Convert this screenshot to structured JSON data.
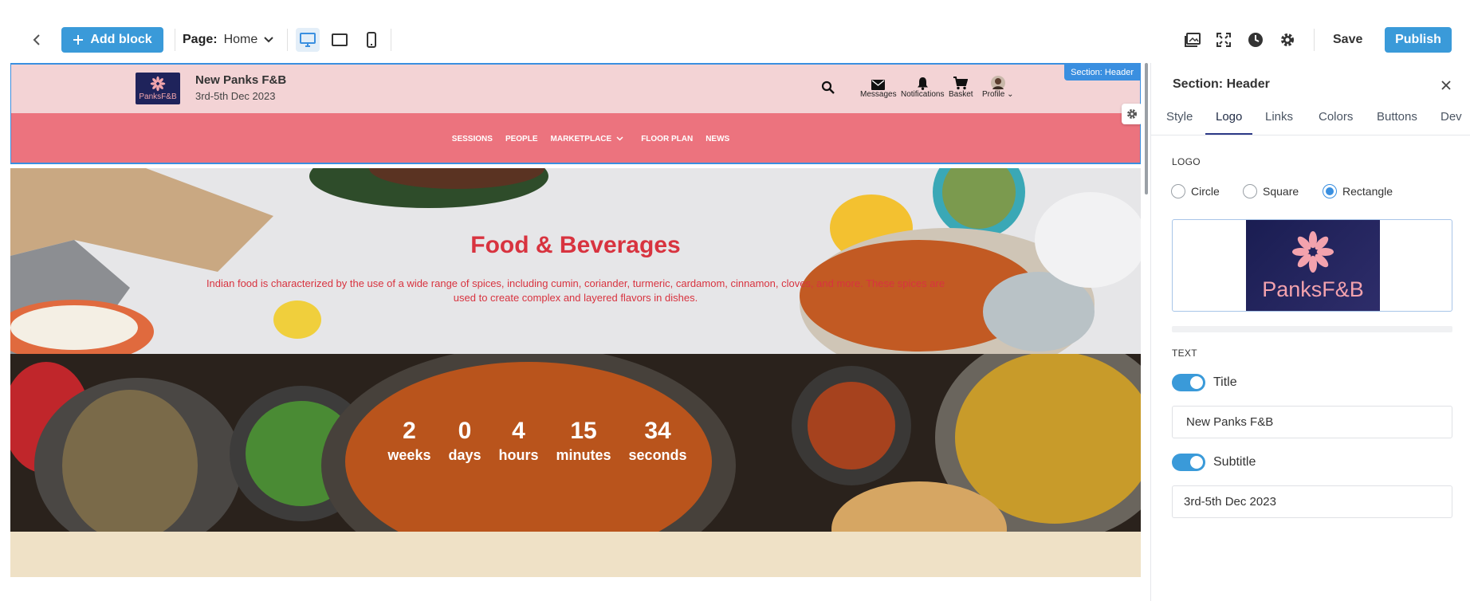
{
  "toolbar": {
    "add_block_label": "Add block",
    "page_label": "Page:",
    "page_value": "Home",
    "save_label": "Save",
    "publish_label": "Publish",
    "accent": "#3a9ad9"
  },
  "header": {
    "section_tag": "Section: Header",
    "logo_text": "PanksF&B",
    "title": "New Panks F&B",
    "subtitle": "3rd-5th Dec 2023",
    "icons": [
      {
        "label": "Messages",
        "icon": "mail-icon"
      },
      {
        "label": "Notifications",
        "icon": "bell-icon"
      },
      {
        "label": "Basket",
        "icon": "cart-icon"
      },
      {
        "label": "Profile",
        "icon": "avatar"
      }
    ],
    "nav": [
      "SESSIONS",
      "PEOPLE",
      "MARKETPLACE",
      "FLOOR PLAN",
      "NEWS"
    ],
    "top_color": "#f3d3d5",
    "nav_color": "#ec737e"
  },
  "hero": {
    "title": "Food & Beverages",
    "description": "Indian food is characterized by the use of a wide range of spices, including cumin, coriander, turmeric, cardamom, cinnamon, cloves, and more. These spices are used to create complex and layered flavors in dishes.",
    "text_color": "#d8333f"
  },
  "countdown": [
    {
      "value": "2",
      "label": "weeks"
    },
    {
      "value": "0",
      "label": "days"
    },
    {
      "value": "4",
      "label": "hours"
    },
    {
      "value": "15",
      "label": "minutes"
    },
    {
      "value": "34",
      "label": "seconds"
    }
  ],
  "panel": {
    "title": "Section: Header",
    "tabs": [
      "Style",
      "Logo",
      "Links",
      "Colors",
      "Buttons",
      "Dev"
    ],
    "active_tab": "Logo",
    "logo_section": "LOGO",
    "shapes": [
      "Circle",
      "Square",
      "Rectangle"
    ],
    "selected_shape": "Rectangle",
    "text_section": "TEXT",
    "title_toggle": "Title",
    "title_value": "New Panks F&B",
    "subtitle_toggle": "Subtitle",
    "subtitle_value": "3rd-5th Dec 2023"
  }
}
